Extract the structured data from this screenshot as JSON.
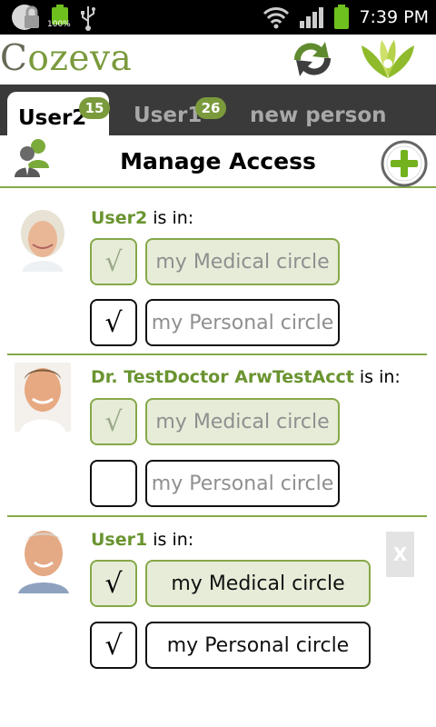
{
  "status_bar": {
    "battery_percent": "100%",
    "time": "7:39 PM",
    "icons": [
      "lock-icon",
      "battery-icon",
      "usb-icon",
      "wifi-icon",
      "signal-icon",
      "battery-icon"
    ]
  },
  "app": {
    "logo_first": "C",
    "logo_rest": "ozeva",
    "sync_icon": "sync-icon",
    "brand_icon": "cozeva-leaf-icon"
  },
  "tabs": [
    {
      "label": "User2",
      "badge": "15",
      "active": true
    },
    {
      "label": "User1",
      "badge": "26",
      "active": false
    },
    {
      "label": "new person",
      "badge": "",
      "active": false
    }
  ],
  "manage": {
    "title": "Manage Access",
    "people_icon": "people-icon",
    "add_icon": "add-circle-icon"
  },
  "people": [
    {
      "name": "User2",
      "suffix": " is in:",
      "medical_check": "√",
      "medical_label": "my Medical circle",
      "personal_check": "√",
      "personal_label": "my Personal circle"
    },
    {
      "name": "Dr. TestDoctor ArwTestAcct",
      "suffix": " is in:",
      "medical_check": "√",
      "medical_label": "my Medical circle",
      "personal_check": "",
      "personal_label": "my Personal circle"
    },
    {
      "name": "User1",
      "suffix": " is in:",
      "medical_check": "√",
      "medical_label": "my Medical circle",
      "personal_check": "√",
      "personal_label": "my Personal circle",
      "remove_label": "X"
    }
  ],
  "colors": {
    "brand_green": "#7a9a3c",
    "tab_bg": "#3a3a3a",
    "light_green": "#e6ecd8"
  }
}
